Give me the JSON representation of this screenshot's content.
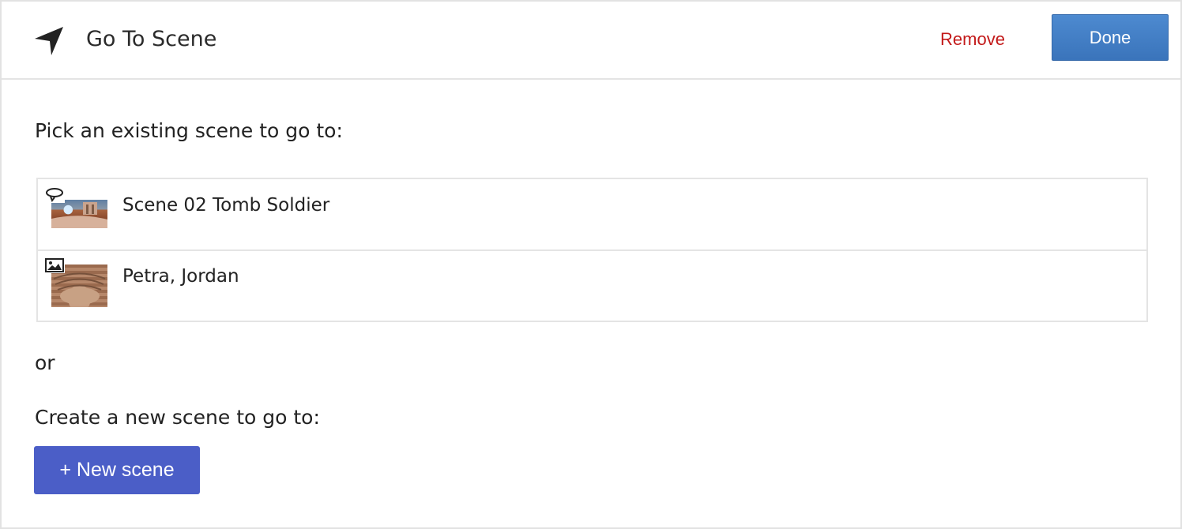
{
  "header": {
    "title": "Go To Scene",
    "remove_label": "Remove",
    "done_label": "Done"
  },
  "content": {
    "pick_prompt": "Pick an existing scene to go to:",
    "separator": "or",
    "create_prompt": "Create a new scene to go to:",
    "new_scene_label": "+ New scene"
  },
  "scenes": [
    {
      "name": "Scene 02 Tomb Soldier",
      "type_icon": "panorama-icon"
    },
    {
      "name": "Petra, Jordan",
      "type_icon": "image-icon"
    }
  ],
  "colors": {
    "remove": "#c31a1a",
    "done": "#3f7bc4",
    "new_scene": "#4b5ec7"
  }
}
